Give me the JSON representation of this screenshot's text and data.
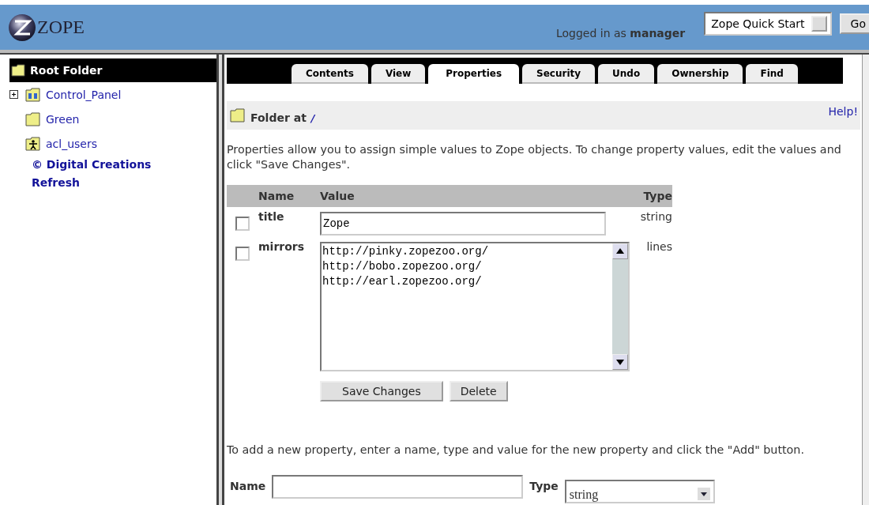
{
  "header": {
    "logo": "ZOPE",
    "login_prefix": "Logged in as",
    "user": "manager",
    "quick_menu": "Zope Quick Start",
    "go_button": "Go"
  },
  "tree": {
    "root": "Root Folder",
    "items": [
      {
        "label": "Control_Panel",
        "kind": "panel",
        "expandable": true
      },
      {
        "label": "Green",
        "kind": "folder",
        "expandable": false
      },
      {
        "label": "acl_users",
        "kind": "users",
        "expandable": false
      }
    ],
    "links": [
      "© Digital Creations",
      "Refresh"
    ]
  },
  "tabs": [
    {
      "label": "Contents",
      "selected": false
    },
    {
      "label": "View",
      "selected": false
    },
    {
      "label": "Properties",
      "selected": true
    },
    {
      "label": "Security",
      "selected": false
    },
    {
      "label": "Undo",
      "selected": false
    },
    {
      "label": "Ownership",
      "selected": false
    },
    {
      "label": "Find",
      "selected": false
    }
  ],
  "location": {
    "label": "Folder at",
    "path": "/",
    "help": "Help!"
  },
  "intro": "Properties allow you to assign simple values to Zope objects. To change property values, edit the values and click \"Save Changes\".",
  "table": {
    "columns": [
      "Name",
      "Value",
      "Type"
    ],
    "rows": [
      {
        "name": "title",
        "kind": "string",
        "value": "Zope",
        "type": "string",
        "checked": false
      },
      {
        "name": "mirrors",
        "kind": "lines",
        "value": "http://pinky.zopezoo.org/\nhttp://bobo.zopezoo.org/\nhttp://earl.zopezoo.org/",
        "type": "lines",
        "checked": false
      }
    ]
  },
  "buttons": [
    "Save Changes",
    "Delete"
  ],
  "add_intro": "To add a new property, enter a name, type and value for the new property and click the \"Add\" button.",
  "add_form": {
    "name_label": "Name",
    "type_label": "Type",
    "type_value": "string"
  }
}
